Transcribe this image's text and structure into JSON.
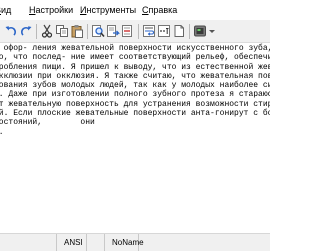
{
  "menu": {
    "items": [
      {
        "label": "Вид",
        "accel_index": 0
      },
      {
        "label": "Настройки",
        "accel_index": 0
      },
      {
        "label": "Инструменты",
        "accel_index": 0
      },
      {
        "label": "Справка",
        "accel_index": 0
      }
    ]
  },
  "toolbar": {
    "buttons": [
      {
        "name": "undo-icon"
      },
      {
        "name": "redo-icon"
      },
      {
        "name": "cut-icon"
      },
      {
        "name": "copy-icon"
      },
      {
        "name": "paste-icon"
      },
      {
        "name": "find-icon"
      },
      {
        "name": "replace-icon"
      },
      {
        "name": "goto-icon"
      },
      {
        "name": "word-wrap-icon"
      },
      {
        "name": "show-whitespace-icon"
      },
      {
        "name": "document-icon"
      },
      {
        "name": "scheme-icon"
      }
    ]
  },
  "editor": {
    "lines": [
      "ю офор- ления жевательной поверхности искусственного зуба, к посте",
      "то, что послед- ние имеет соответствующий рельеф, обеспечивающий ее",
      "еробления пищи. Я пришел к выводу, что из естественной жевательной по",
      "окклюзии при окклюзия. Я также считаю, что жевательная поверхность зубного",
      "нования зубов молодых людей, так как у молодых наиболее сильно представ",
      "и. Даже при изготовлении полного зубного протеза я стараюсь воспроизв",
      "ют жевательную поверхность для устранения возможности стирания зубов",
      "ый. Если плоские жевательные поверхности анта-гонирут с большими",
      "состояний,        они",
      "о."
    ]
  },
  "status": {
    "encoding": "ANSI",
    "scheme": "NoName"
  }
}
